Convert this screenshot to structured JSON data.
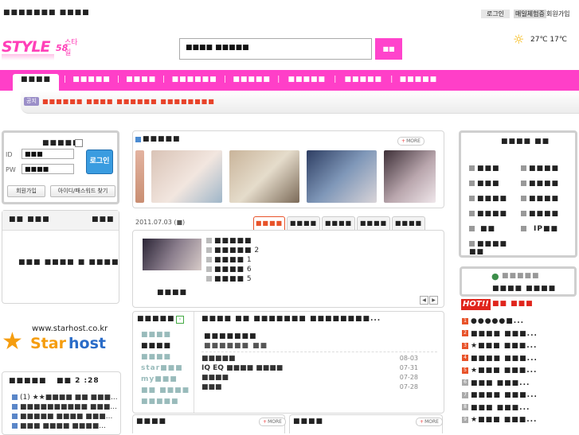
{
  "top": {
    "breadcrumb": "■■■■■■■ ■■■■",
    "login": "로그인",
    "checkin": "매일체험증",
    "signup": "회원가입"
  },
  "header": {
    "logo_main": "STYLE",
    "logo_sub": "스타일",
    "logo_num": "58",
    "search_value": "■■■■ ■■■■■",
    "search_button": "■■",
    "weather": "27℃ 17℃"
  },
  "nav": {
    "items": [
      "■■■■",
      "■■■■■",
      "■■■■",
      "■■■■■■",
      "■■■■■",
      "■■■■■",
      "■■■■■",
      "■■■■■"
    ],
    "notice_label": "공지",
    "notice_text": "■■■■■■ ■■■■ ■■■■■■ ■■■■■■■■"
  },
  "login_box": {
    "title": "■■■■■",
    "id_label": "ID",
    "pw_label": "PW",
    "id_value": "■■■",
    "pw_value": "■■■■",
    "login_button": "로그인",
    "signup_button": "회원가입",
    "find_button": "아이디/패스워드 찾기"
  },
  "left_panel": {
    "title": "■■ ■■■",
    "right": "■■■",
    "message": "■■■ ■■■■ ■ ■■■■"
  },
  "starhost": {
    "url": "www.starhost.co.kr",
    "name_a": "Star",
    "name_b": "host"
  },
  "left_list": {
    "title": "■■■■■",
    "meta": "■■  2  :28",
    "items": [
      "(1) ★★■■■■ ■■ ■■■...",
      "■■■■■■■■■■ ■■■...",
      "■■■■■ ■■■■ ■■■...",
      "■■■ ■■■■ ■■■■..."
    ]
  },
  "photos": {
    "title": "■■■■■",
    "more": "MORE",
    "colors": [
      "#c98e72",
      "#e8d2c4",
      "#b9a78a",
      "#6b7f9c",
      "#5f4c56"
    ]
  },
  "article": {
    "date": "2011.07.03 (■)",
    "tabs": [
      "■■■■",
      "■■■■",
      "■■■■",
      "■■■■",
      "■■■■"
    ],
    "items": [
      {
        "text": "■■■■■",
        "n": ""
      },
      {
        "text": "■■■■■",
        "n": "2"
      },
      {
        "text": "■■■■",
        "n": "1"
      },
      {
        "text": "■■■■",
        "n": "6"
      },
      {
        "text": "■■■■",
        "n": "5"
      }
    ],
    "caption": "■■■■"
  },
  "board": {
    "title": "■■■■■",
    "side_items": [
      "■■■■",
      "■■■■",
      "■■■■",
      "star■■■",
      "my■■■",
      "■■ ■■■■",
      "■■■■■"
    ],
    "headline": "■■■■ ■■ ■■■■■■■ ■■■■■■■■...",
    "summary1": "■■■■■■■",
    "summary2": "■■■■■■ ■■",
    "rows": [
      {
        "title": "■■■■■",
        "date": "08-03"
      },
      {
        "title": "IQ EQ ■■■■ ■■■■",
        "date": "07-31"
      },
      {
        "title": "■■■■",
        "date": "07-28"
      },
      {
        "title": "■■■",
        "date": "07-28"
      }
    ]
  },
  "bottom_boxes": [
    {
      "title": "■■■■",
      "more": "MORE"
    },
    {
      "title": "■■■■",
      "more": "MORE"
    }
  ],
  "right_links": {
    "title": "■■■■ ■■",
    "col1": [
      "■■■",
      "■■■",
      "■■■■",
      "■■■■",
      "■■",
      "■■■■ ■■"
    ],
    "col2": [
      "■■■■",
      "■■■■",
      "■■■■",
      "■■■■",
      "IP■■"
    ]
  },
  "right_mid": {
    "title": "■■■■■",
    "text": "■■■■ ■■■■"
  },
  "hot": {
    "badge": "HOT!!",
    "title": "■■ ■■■",
    "items": [
      "●●●●●■...",
      "■■■■ ■■■...",
      "★■■■ ■■■...",
      "■■■■ ■■■...",
      "★■■■ ■■■...",
      "■■■ ■■■...",
      "■■■■ ■■■...",
      "■■■ ■■■...",
      "★■■■ ■■■..."
    ],
    "num_colors": [
      "#e8532a",
      "#e8532a",
      "#e8532a",
      "#e8532a",
      "#e8532a",
      "#aaaaaa",
      "#aaaaaa",
      "#aaaaaa",
      "#aaaaaa"
    ]
  }
}
